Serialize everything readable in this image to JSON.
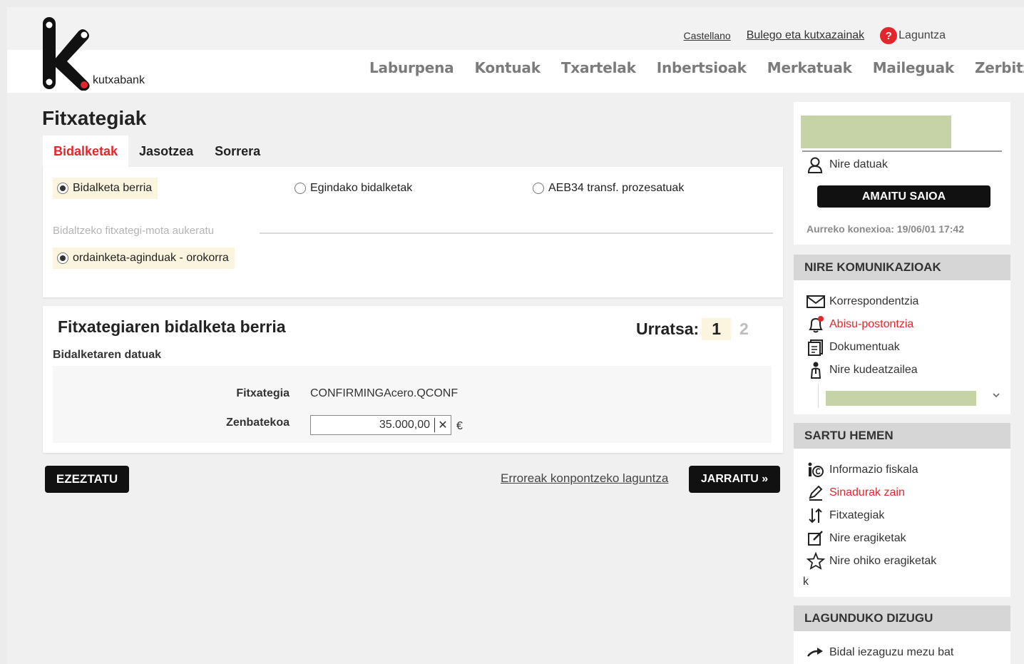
{
  "brand": {
    "logo_text": "kutxabank"
  },
  "top_links": {
    "language": "Castellano",
    "offices": "Bulego eta kutxazainak",
    "help": "Laguntza",
    "help_icon_glyph": "?"
  },
  "main_nav": [
    "Laburpena",
    "Kontuak",
    "Txartelak",
    "Inbertsioak",
    "Merkatuak",
    "Maileguak",
    "Zerbitzuak"
  ],
  "page": {
    "title": "Fitxategiak"
  },
  "tabs": [
    "Bidalketak",
    "Jasotzea",
    "Sorrera"
  ],
  "options": {
    "radios": [
      "Bidalketa berria",
      "Egindako bidalketak",
      "AEB34 transf. prozesatuak"
    ],
    "file_type_label": "Bidaltzeko fitxategi-mota aukeratu",
    "file_type_option": "ordainketa-aginduak - orokorra"
  },
  "form": {
    "title": "Fitxategiaren bidalketa berria",
    "step_label": "Urratsa:",
    "step_current": "1",
    "step_next": "2",
    "subtitle": "Bidalketaren datuak",
    "file_label": "Fitxategia",
    "file_value": "CONFIRMINGAcero.QCONF",
    "amount_label": "Zenbatekoa",
    "amount_value": "35.000,00",
    "clear_glyph": "✕",
    "currency": "€"
  },
  "actions": {
    "cancel": "EZEZTATU",
    "help_link": "Erroreak konpontzeko laguntza",
    "continue": "JARRAITU »"
  },
  "sidebar": {
    "my_data": "Nire datuak",
    "logout": "AMAITU SAIOA",
    "last_connection": "Aurreko konexioa: 19/06/01 17:42",
    "comms_title": "NIRE KOMUNIKAZIOAK",
    "comms": [
      "Korrespondentzia",
      "Abisu-postontzia",
      "Dokumentuak",
      "Nire kudeatzailea"
    ],
    "access_title": "SARTU HEMEN",
    "access": [
      "Informazio fiskala",
      "Sinadurak zain",
      "Fitxategiak",
      "Nire eragiketak",
      "Nire ohiko eragiketak"
    ],
    "stray_char": "k",
    "help_title": "LAGUNDUKO DIZUGU",
    "help_items": [
      "Bidal iezaguzu mezu bat"
    ]
  },
  "colors": {
    "accent_red": "#e3262c",
    "dark_button": "#111111",
    "highlight": "#fbf5df",
    "redaction": "#c5d3a7"
  }
}
